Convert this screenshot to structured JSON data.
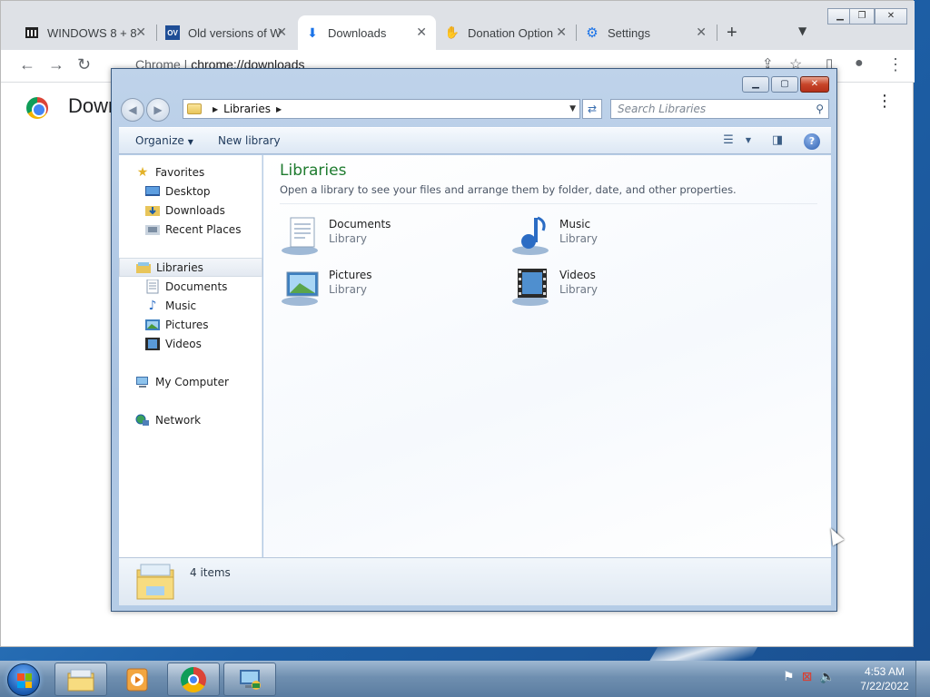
{
  "chrome": {
    "tabs": [
      {
        "title": "WINDOWS 8 + 8",
        "icon": "archive-icon"
      },
      {
        "title": "Old versions of W",
        "icon": "ov-icon"
      },
      {
        "title": "Downloads",
        "icon": "download-icon"
      },
      {
        "title": "Donation Option",
        "icon": "donation-icon"
      },
      {
        "title": "Settings",
        "icon": "gear-icon"
      }
    ],
    "new_tab": "+",
    "url_site": "Chrome",
    "url_path": "chrome://downloads",
    "page_title": "Down"
  },
  "explorer": {
    "address": "Libraries",
    "search_placeholder": "Search Libraries",
    "toolbar": {
      "organize": "Organize",
      "new_library": "New library"
    },
    "nav": {
      "favorites": "Favorites",
      "favorites_items": [
        "Desktop",
        "Downloads",
        "Recent Places"
      ],
      "libraries": "Libraries",
      "libraries_items": [
        "Documents",
        "Music",
        "Pictures",
        "Videos"
      ],
      "computer": "My Computer",
      "network": "Network"
    },
    "heading": "Libraries",
    "description": "Open a library to see your files and arrange them by folder, date, and other properties.",
    "libraries": [
      {
        "name": "Documents",
        "type": "Library"
      },
      {
        "name": "Music",
        "type": "Library"
      },
      {
        "name": "Pictures",
        "type": "Library"
      },
      {
        "name": "Videos",
        "type": "Library"
      }
    ],
    "status": "4 items"
  },
  "taskbar": {
    "time": "4:53 AM",
    "date": "7/22/2022"
  }
}
